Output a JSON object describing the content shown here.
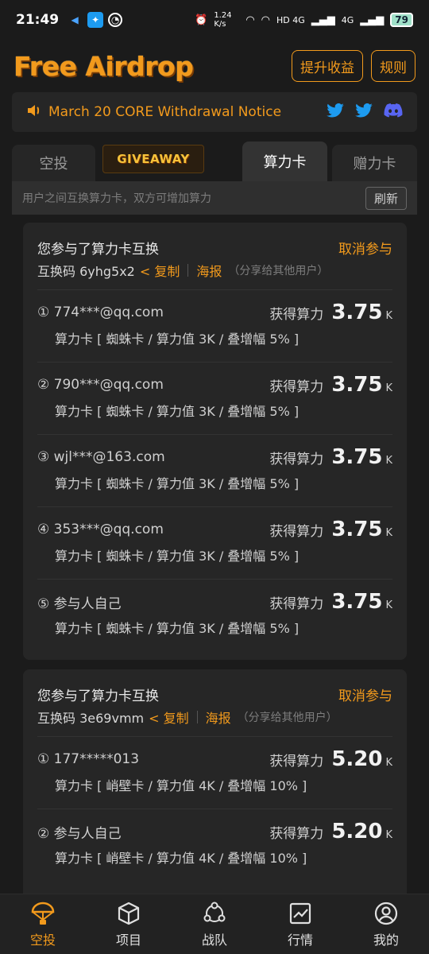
{
  "status": {
    "time": "21:49",
    "speed": "1.24 K/s",
    "net1": "HD 4G",
    "net2": "4G",
    "battery": "79"
  },
  "header": {
    "logo": "Free Airdrop",
    "btn_earn": "提升收益",
    "btn_rules": "规则"
  },
  "notice": {
    "text": "March 20 CORE Withdrawal Notice"
  },
  "tabs": {
    "airdrop": "空投",
    "giveaway": "GIVEAWAY",
    "hashcard": "算力卡",
    "gift": "赠力卡"
  },
  "subbar": {
    "hint": "用户之间互换算力卡，双方可增加算力",
    "refresh": "刷新"
  },
  "cards": [
    {
      "title": "您参与了算力卡互换",
      "cancel": "取消参与",
      "code_label": "互换码 6yhg5x2",
      "copy": "< 复制",
      "poster": "海报",
      "share": "（分享给其他用户）",
      "rows": [
        {
          "user": "① 774***@qq.com",
          "gain_label": "获得算力",
          "gain": "3.75",
          "unit": "K",
          "card": "算力卡 [ 蜘蛛卡 / 算力值 3K / 叠增幅 5% ]"
        },
        {
          "user": "② 790***@qq.com",
          "gain_label": "获得算力",
          "gain": "3.75",
          "unit": "K",
          "card": "算力卡 [ 蜘蛛卡 / 算力值 3K / 叠增幅 5% ]"
        },
        {
          "user": "③ wjl***@163.com",
          "gain_label": "获得算力",
          "gain": "3.75",
          "unit": "K",
          "card": "算力卡 [ 蜘蛛卡 / 算力值 3K / 叠增幅 5% ]"
        },
        {
          "user": "④ 353***@qq.com",
          "gain_label": "获得算力",
          "gain": "3.75",
          "unit": "K",
          "card": "算力卡 [ 蜘蛛卡 / 算力值 3K / 叠增幅 5% ]"
        },
        {
          "user": "⑤ 参与人自己",
          "gain_label": "获得算力",
          "gain": "3.75",
          "unit": "K",
          "card": "算力卡 [ 蜘蛛卡 / 算力值 3K / 叠增幅 5% ]"
        }
      ]
    },
    {
      "title": "您参与了算力卡互换",
      "cancel": "取消参与",
      "code_label": "互换码 3e69vmm",
      "copy": "< 复制",
      "poster": "海报",
      "share": "（分享给其他用户）",
      "rows": [
        {
          "user": "① 177*****013",
          "gain_label": "获得算力",
          "gain": "5.20",
          "unit": "K",
          "card": "算力卡 [ 峭壁卡 / 算力值 4K / 叠增幅 10% ]"
        },
        {
          "user": "② 参与人自己",
          "gain_label": "获得算力",
          "gain": "5.20",
          "unit": "K",
          "card": "算力卡 [ 峭壁卡 / 算力值 4K / 叠增幅 10% ]"
        }
      ]
    }
  ],
  "nav": {
    "airdrop": "空投",
    "project": "项目",
    "team": "战队",
    "market": "行情",
    "mine": "我的"
  },
  "colors": {
    "accent": "#f29a1c",
    "background": "#1b1b1b",
    "card": "#262626",
    "twitter": "#1d9bf0",
    "discord": "#5865f2"
  }
}
